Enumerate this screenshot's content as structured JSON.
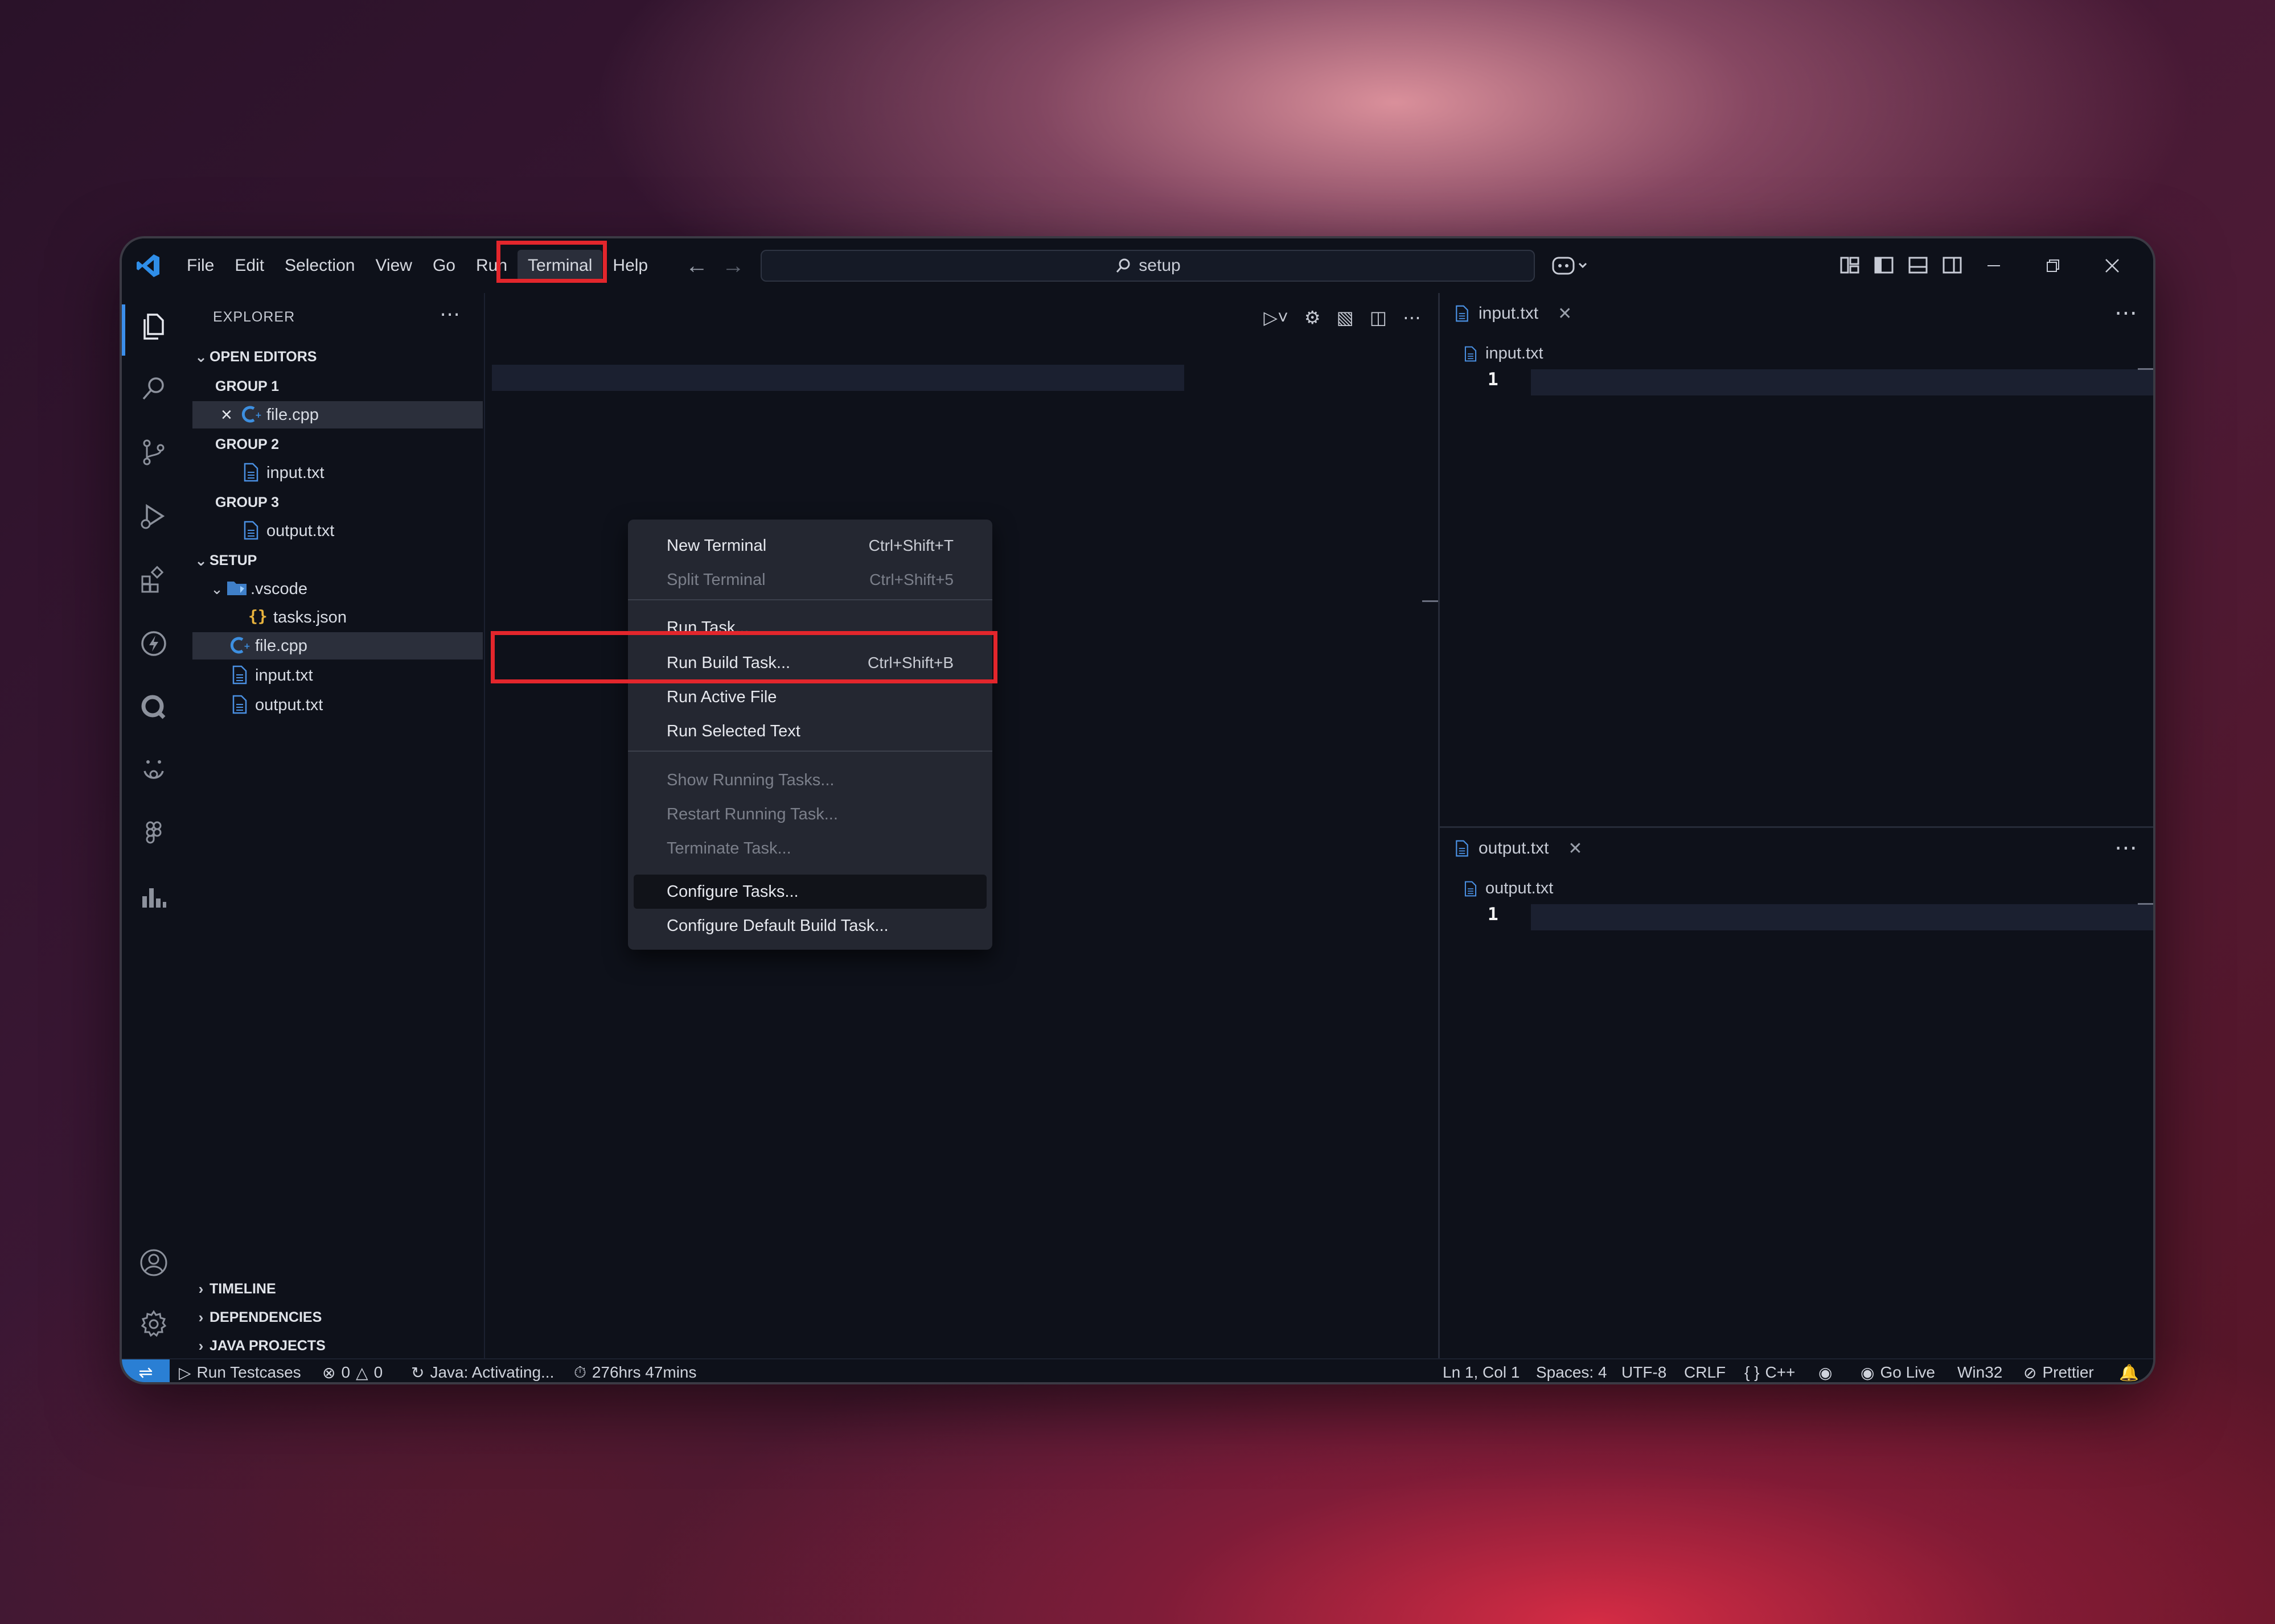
{
  "titlebar": {
    "menu": [
      "File",
      "Edit",
      "Selection",
      "View",
      "Go",
      "Run",
      "Terminal",
      "Help"
    ],
    "active_menu": "Terminal",
    "command_center": "setup"
  },
  "sidebar": {
    "title": "EXPLORER",
    "open_editors": "OPEN EDITORS",
    "group1": "GROUP 1",
    "group1_file": "file.cpp",
    "group2": "GROUP 2",
    "group2_file": "input.txt",
    "group3": "GROUP 3",
    "group3_file": "output.txt",
    "folder": "SETUP",
    "subfolder": ".vscode",
    "tasks": "tasks.json",
    "files": [
      "file.cpp",
      "input.txt",
      "output.txt"
    ],
    "timeline": "TIMELINE",
    "dependencies": "DEPENDENCIES",
    "java_projects": "JAVA PROJECTS"
  },
  "terminal_menu": {
    "items": [
      {
        "label": "New Terminal",
        "shortcut": "Ctrl+Shift+T",
        "enabled": true
      },
      {
        "label": "Split Terminal",
        "shortcut": "Ctrl+Shift+5",
        "enabled": false
      },
      {
        "label": "Run Task...",
        "shortcut": "",
        "enabled": true
      },
      {
        "label": "Run Build Task...",
        "shortcut": "Ctrl+Shift+B",
        "enabled": true
      },
      {
        "label": "Run Active File",
        "shortcut": "",
        "enabled": true
      },
      {
        "label": "Run Selected Text",
        "shortcut": "",
        "enabled": true
      },
      {
        "label": "Show Running Tasks...",
        "shortcut": "",
        "enabled": false
      },
      {
        "label": "Restart Running Task...",
        "shortcut": "",
        "enabled": false
      },
      {
        "label": "Terminate Task...",
        "shortcut": "",
        "enabled": false
      },
      {
        "label": "Configure Tasks...",
        "shortcut": "",
        "enabled": true,
        "highlighted": true
      },
      {
        "label": "Configure Default Build Task...",
        "shortcut": "",
        "enabled": true
      }
    ]
  },
  "editors": {
    "group2": {
      "tab": "input.txt",
      "breadcrumb": "input.txt",
      "line": "1"
    },
    "group3": {
      "tab": "output.txt",
      "breadcrumb": "output.txt",
      "line": "1"
    }
  },
  "statusbar": {
    "run_testcases": "Run Testcases",
    "errors": "0",
    "warnings": "0",
    "java": "Java: Activating...",
    "time": "276hrs 47mins",
    "position": "Ln 1, Col 1",
    "spaces": "Spaces: 4",
    "encoding": "UTF-8",
    "eol": "CRLF",
    "language": "C++",
    "golive": "Go Live",
    "platform": "Win32",
    "prettier": "Prettier"
  },
  "colors": {
    "highlight_box": "#e3262c",
    "accent": "#2a7fd4",
    "editor_bg": "#0e111a"
  }
}
